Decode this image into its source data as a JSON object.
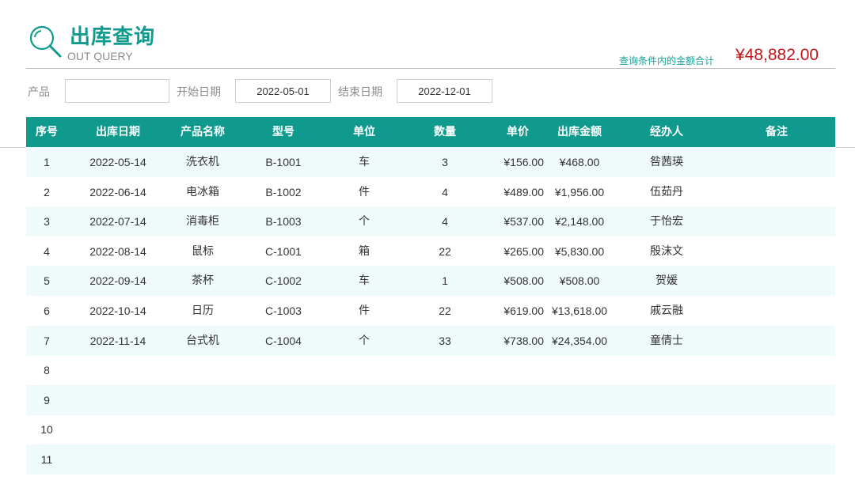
{
  "header": {
    "title": "出库查询",
    "subtitle": "OUT QUERY",
    "total_label": "查询条件内的金额合计",
    "total_value": "¥48,882.00",
    "icon": "magnifier-icon",
    "accent_color": "#0f9a8d",
    "total_color": "#c0161b"
  },
  "filters": {
    "product_label": "产品",
    "product_value": "",
    "start_label": "开始日期",
    "start_value": "2022-05-01",
    "end_label": "结束日期",
    "end_value": "2022-12-01"
  },
  "table": {
    "columns": [
      "序号",
      "出库日期",
      "产品名称",
      "型号",
      "单位",
      "数量",
      "单价",
      "出库金额",
      "经办人",
      "备注"
    ],
    "rows": [
      {
        "no": "1",
        "date": "2022-05-14",
        "product": "洗衣机",
        "model": "B-1001",
        "unit": "车",
        "qty": "3",
        "price": "¥156.00",
        "amount": "¥468.00",
        "handler": "咎茜瑛",
        "remark": ""
      },
      {
        "no": "2",
        "date": "2022-06-14",
        "product": "电冰箱",
        "model": "B-1002",
        "unit": "件",
        "qty": "4",
        "price": "¥489.00",
        "amount": "¥1,956.00",
        "handler": "伍茹丹",
        "remark": ""
      },
      {
        "no": "3",
        "date": "2022-07-14",
        "product": "消毒柜",
        "model": "B-1003",
        "unit": "个",
        "qty": "4",
        "price": "¥537.00",
        "amount": "¥2,148.00",
        "handler": "于怡宏",
        "remark": ""
      },
      {
        "no": "4",
        "date": "2022-08-14",
        "product": "鼠标",
        "model": "C-1001",
        "unit": "箱",
        "qty": "22",
        "price": "¥265.00",
        "amount": "¥5,830.00",
        "handler": "殷沫文",
        "remark": ""
      },
      {
        "no": "5",
        "date": "2022-09-14",
        "product": "茶杯",
        "model": "C-1002",
        "unit": "车",
        "qty": "1",
        "price": "¥508.00",
        "amount": "¥508.00",
        "handler": "贺媛",
        "remark": ""
      },
      {
        "no": "6",
        "date": "2022-10-14",
        "product": "日历",
        "model": "C-1003",
        "unit": "件",
        "qty": "22",
        "price": "¥619.00",
        "amount": "¥13,618.00",
        "handler": "戚云融",
        "remark": ""
      },
      {
        "no": "7",
        "date": "2022-11-14",
        "product": "台式机",
        "model": "C-1004",
        "unit": "个",
        "qty": "33",
        "price": "¥738.00",
        "amount": "¥24,354.00",
        "handler": "童倩士",
        "remark": ""
      },
      {
        "no": "8",
        "date": "",
        "product": "",
        "model": "",
        "unit": "",
        "qty": "",
        "price": "",
        "amount": "",
        "handler": "",
        "remark": ""
      },
      {
        "no": "9",
        "date": "",
        "product": "",
        "model": "",
        "unit": "",
        "qty": "",
        "price": "",
        "amount": "",
        "handler": "",
        "remark": ""
      },
      {
        "no": "10",
        "date": "",
        "product": "",
        "model": "",
        "unit": "",
        "qty": "",
        "price": "",
        "amount": "",
        "handler": "",
        "remark": ""
      },
      {
        "no": "11",
        "date": "",
        "product": "",
        "model": "",
        "unit": "",
        "qty": "",
        "price": "",
        "amount": "",
        "handler": "",
        "remark": ""
      }
    ]
  }
}
